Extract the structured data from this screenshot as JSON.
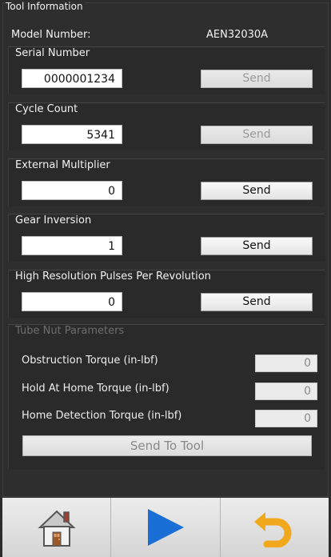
{
  "tool_info": {
    "legend": "Tool Information",
    "model_label": "Model Number:",
    "model_value": "AEN32030A"
  },
  "serial": {
    "title": "Serial Number",
    "value": "0000001234",
    "button": "Send",
    "button_enabled": false
  },
  "cycle": {
    "title": "Cycle Count",
    "value": "5341",
    "button": "Send",
    "button_enabled": false
  },
  "multiplier": {
    "title": "External Multiplier",
    "value": "0",
    "button": "Send",
    "button_enabled": true
  },
  "gear": {
    "title": "Gear Inversion",
    "value": "1",
    "button": "Send",
    "button_enabled": true
  },
  "pulses": {
    "title": "High Resolution Pulses Per Revolution",
    "value": "0",
    "button": "Send",
    "button_enabled": true
  },
  "tube": {
    "title": "Tube Nut Parameters",
    "obstruction_label": "Obstruction Torque (in-lbf)",
    "obstruction_value": "0",
    "hold_label": "Hold At Home Torque (in-lbf)",
    "hold_value": "0",
    "detect_label": "Home Detection Torque (in-lbf)",
    "detect_value": "0",
    "send_button": "Send To Tool"
  },
  "bottom_bar": {
    "icons": [
      "home-icon",
      "play-icon",
      "undo-icon"
    ],
    "colors": {
      "play": "#1a6fd6",
      "undo": "#f2a81d"
    }
  }
}
